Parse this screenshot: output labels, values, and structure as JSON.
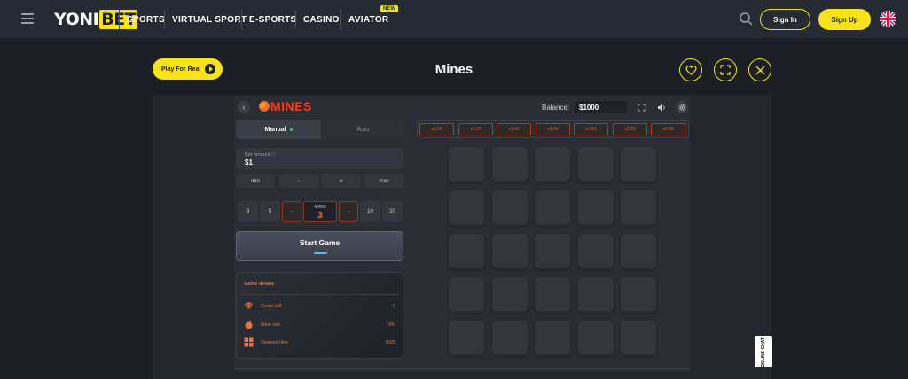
{
  "brand": {
    "part1": "YONI",
    "part2": "BET"
  },
  "nav": {
    "items": [
      "SPORTS",
      "VIRTUAL SPORT",
      "E-SPORTS",
      "CASINO",
      "AVIATOR"
    ],
    "new_badge": "NEW"
  },
  "auth": {
    "signin_label": "Sign In",
    "signup_label": "Sign Up"
  },
  "game_header": {
    "play_real_label": "Play For Real",
    "title": "Mines"
  },
  "game": {
    "logo_text": "MINES",
    "balance_label": "Balance:",
    "balance_value": "$1000",
    "tabs": {
      "manual": "Manual",
      "auto": "Auto"
    },
    "bet": {
      "label": "Bet Amount ⓘ",
      "value": "$1"
    },
    "bet_buttons": [
      "min",
      "-",
      "+",
      "max"
    ],
    "mine_buttons_left": [
      "3",
      "5"
    ],
    "mine_minus": "-",
    "mine_plus": "-",
    "mine_buttons_right": [
      "10",
      "20"
    ],
    "mines_label": "Mines",
    "mines_value": "3",
    "start_label": "Start Game",
    "details": {
      "title": "Game details",
      "rows": [
        {
          "label": "Gems left",
          "value": "0"
        },
        {
          "label": "Mine risk",
          "value": "0%"
        },
        {
          "label": "Opened tiles",
          "value": "0/25"
        }
      ]
    },
    "multipliers": [
      "x1.08",
      "x1.23",
      "x1.42",
      "x1.64",
      "x1.93",
      "x2.29",
      "x2.68"
    ],
    "grid": {
      "rows": 5,
      "cols": 5
    }
  },
  "side_badge": "ONLINE CHAT",
  "colors": {
    "accent": "#f7e21c",
    "game_orange": "#e8763a",
    "bg": "#1c1f26"
  },
  "icons": [
    "hamburger-icon",
    "search-icon",
    "uk-flag-icon",
    "play-icon",
    "heart-icon",
    "fullscreen-icon",
    "close-icon",
    "back-arrow-icon",
    "bomb-icon",
    "expand-icon",
    "sound-icon",
    "settings-icon",
    "gem-icon",
    "mine-icon",
    "tiles-icon"
  ]
}
